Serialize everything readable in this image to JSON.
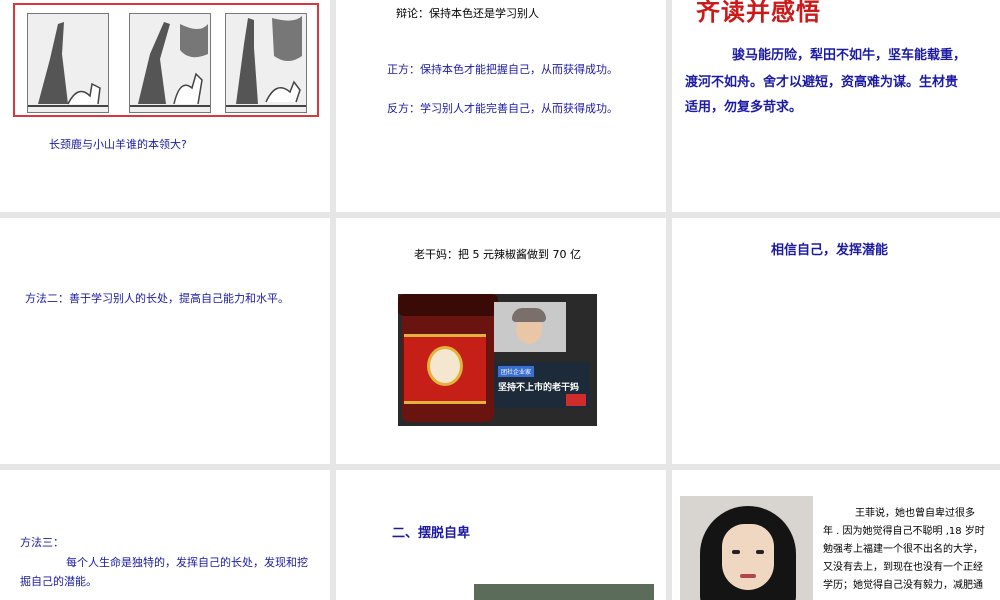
{
  "slide1": {
    "caption": "长颈鹿与小山羊谁的本领大?"
  },
  "slide2": {
    "debate_title": "辩论：保持本色还是学习别人",
    "pro": "正方：保持本色才能把握自己，从而获得成功。",
    "con": "反方：学习别人才能完善自己，从而获得成功。"
  },
  "slide3": {
    "title": "齐读并感悟",
    "para_line1": "骏马能历险，犁田不如牛，坚车能载重，",
    "para_line2": "渡河不如舟。舍才以避短，资高难为谋。生材贵",
    "para_line3": "适用，勿复多苛求。"
  },
  "slide4": {
    "method": "方法二：善于学习别人的长处，提高自己能力和水平。"
  },
  "slide5": {
    "title": "老干妈：把 5 元辣椒酱做到 70 亿",
    "photo_badge": "团社企业家",
    "photo_headline": "坚持不上市的老干妈"
  },
  "slide6": {
    "title": "相信自己，发挥潜能"
  },
  "slide7": {
    "label": "方法三：",
    "line1": "每个人生命是独特的，发挥自己的长处，发现和挖",
    "line2": "掘自己的潜能。"
  },
  "slide8": {
    "heading": "二、摆脱自卑"
  },
  "slide9": {
    "line1": "王菲说，她也曾自卑过很多",
    "line2": "年 . 因为她觉得自己不聪明 ,18 岁时",
    "line3": "勉强考上福建一个很不出名的大学，",
    "line4": "又没有去上，到现在也没有一个正经",
    "line5": "学历；她觉得自己没有毅力，减肥通"
  },
  "colors": {
    "text_blue": "#1a1aa6",
    "title_red": "#cc1a1a",
    "frame_red": "#d9363e",
    "gap_gray": "#e6e6e6"
  }
}
